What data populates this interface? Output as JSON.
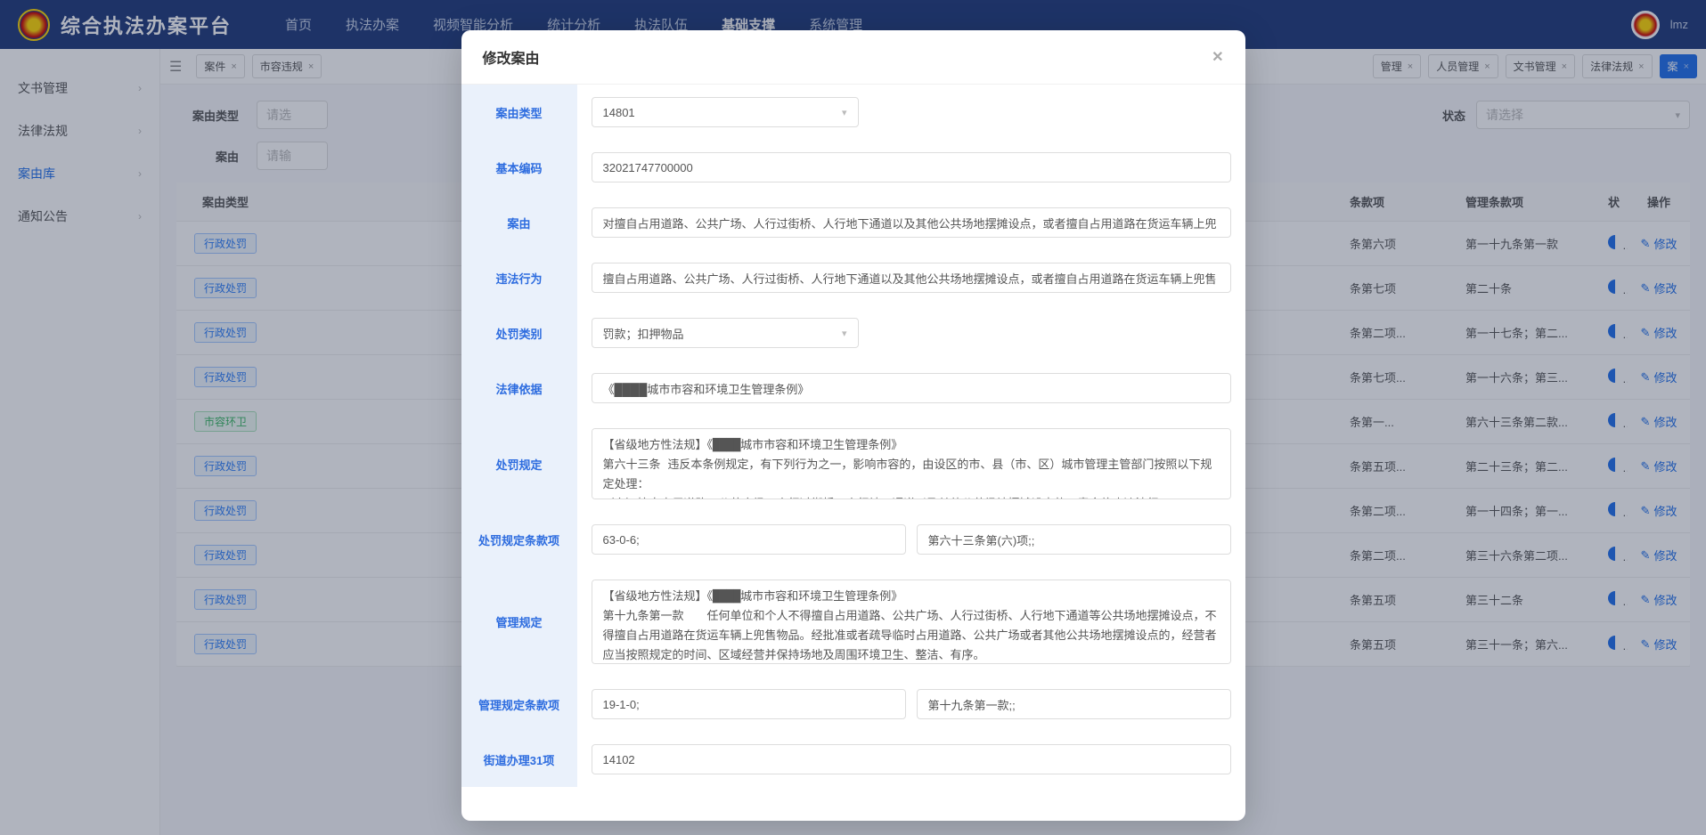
{
  "app_title": "综合执法办案平台",
  "nav": [
    "首页",
    "执法办案",
    "视频智能分析",
    "统计分析",
    "执法队伍",
    "基础支撑",
    "系统管理"
  ],
  "nav_active": 5,
  "user": "lmz",
  "sidebar": [
    {
      "label": "文书管理",
      "active": false
    },
    {
      "label": "法律法规",
      "active": false
    },
    {
      "label": "案由库",
      "active": true
    },
    {
      "label": "通知公告",
      "active": false
    }
  ],
  "tabs_left": [
    {
      "label": "案件"
    },
    {
      "label": "市容违规"
    }
  ],
  "tabs_right": [
    {
      "label": "管理"
    },
    {
      "label": "人员管理"
    },
    {
      "label": "文书管理"
    },
    {
      "label": "法律法规"
    },
    {
      "label": "案",
      "active": true
    }
  ],
  "filters": {
    "type_label": "案由类型",
    "type_ph": "请选",
    "ay_label": "案由",
    "ay_ph": "请输",
    "status_label": "状态",
    "status_ph": "请选择"
  },
  "table": {
    "headers": [
      "案由类型",
      "条款项",
      "管理条款项",
      "状",
      "操作"
    ],
    "edit": "修改",
    "rows": [
      {
        "type": "行政处罚",
        "pc": "条第六项",
        "mg": "第一十九条第一款"
      },
      {
        "type": "行政处罚",
        "pc": "条第七项",
        "mg": "第二十条"
      },
      {
        "type": "行政处罚",
        "pc": "条第二项...",
        "mg": "第一十七条；第二..."
      },
      {
        "type": "行政处罚",
        "pc": "条第七项...",
        "mg": "第一十六条；第三..."
      },
      {
        "type": "市容环卫",
        "green": true,
        "pc": "条第一...",
        "mg": "第六十三条第二款..."
      },
      {
        "type": "行政处罚",
        "pc": "条第五项...",
        "mg": "第二十三条；第二..."
      },
      {
        "type": "行政处罚",
        "pc": "条第二项...",
        "mg": "第一十四条；第一..."
      },
      {
        "type": "行政处罚",
        "pc": "条第二项...",
        "mg": "第三十六条第二项..."
      },
      {
        "type": "行政处罚",
        "pc": "条第五项",
        "mg": "第三十二条"
      },
      {
        "type": "行政处罚",
        "pc": "条第五项",
        "mg": "第三十一条；第六..."
      }
    ]
  },
  "modal": {
    "title": "修改案由",
    "fields": {
      "type_label": "案由类型",
      "type_value": "14801",
      "code_label": "基本编码",
      "code_value": "32021747700000",
      "ay_label": "案由",
      "ay_value": "对擅自占用道路、公共广场、人行过街桥、人行地下通道以及其他公共场地摆摊设点，或者擅自占用道路在货运车辆上兜",
      "illegal_label": "违法行为",
      "illegal_value": "擅自占用道路、公共广场、人行过街桥、人行地下通道以及其他公共场地摆摊设点，或者擅自占用道路在货运车辆上兜售",
      "pcat_label": "处罚类别",
      "pcat_value": "罚款；扣押物品",
      "law_label": "法律依据",
      "law_value": "《████城市市容和环境卫生管理条例》",
      "prule_label": "处罚规定",
      "prule_value": "【省级地方性法规】《████城市市容和环境卫生管理条例》\n第六十三条 违反本条例规定，有下列行为之一，影响市容的，由设区的市、县（市、区）城市管理主管部门按照以下规定处理：\n（六）擅自占用道路、公共广场、人行过街桥、人行地下通道以及其他公共场地摆摊设点的，责令停止违法行",
      "pclause_label": "处罚规定条款项",
      "pclause_a": "63-0-6;",
      "pclause_b": "第六十三条第(六)项;;",
      "mrule_label": "管理规定",
      "mrule_value": "【省级地方性法规】《████城市市容和环境卫生管理条例》\n第十九条第一款　　任何单位和个人不得擅自占用道路、公共广场、人行过街桥、人行地下通道等公共场地摆摊设点，不得擅自占用道路在货运车辆上兜售物品。经批准或者疏导临时占用道路、公共广场或者其他公共场地摆摊设点的，经营者应当按照规定的时间、区域经营并保持场地及周围环境卫生、整洁、有序。",
      "mclause_label": "管理规定条款项",
      "mclause_a": "19-1-0;",
      "mclause_b": "第十九条第一款;;",
      "street_label": "街道办理31项",
      "street_value": "14102"
    }
  }
}
